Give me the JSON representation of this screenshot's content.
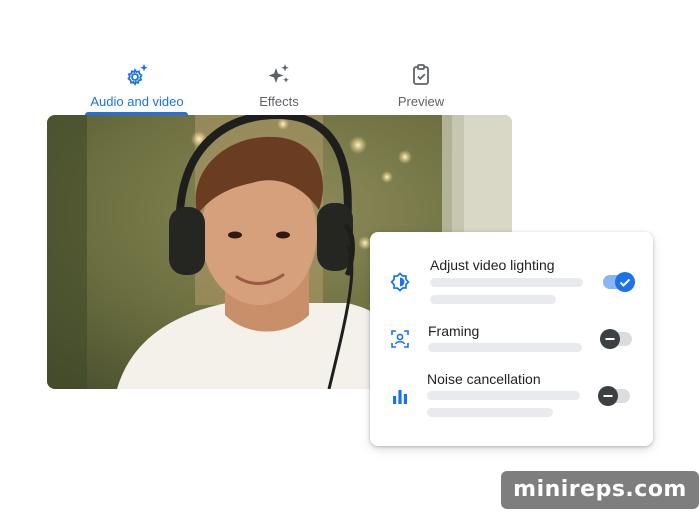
{
  "tabs": [
    {
      "label": "Audio and video",
      "icon": "audio-video-settings-icon",
      "active": true
    },
    {
      "label": "Effects",
      "icon": "sparkle-icon",
      "active": false
    },
    {
      "label": "Preview",
      "icon": "clipboard-check-icon",
      "active": false
    }
  ],
  "settings": [
    {
      "title": "Adjust video lighting",
      "icon": "brightness-auto-icon",
      "enabled": true
    },
    {
      "title": "Framing",
      "icon": "framing-person-icon",
      "enabled": false
    },
    {
      "title": "Noise cancellation",
      "icon": "audio-bars-icon",
      "enabled": false
    }
  ],
  "colors": {
    "accent": "#1a73e8",
    "toggle_track_on": "#8ab4f8",
    "toggle_off_knob": "#3c4043"
  },
  "watermark": "minireps.com"
}
